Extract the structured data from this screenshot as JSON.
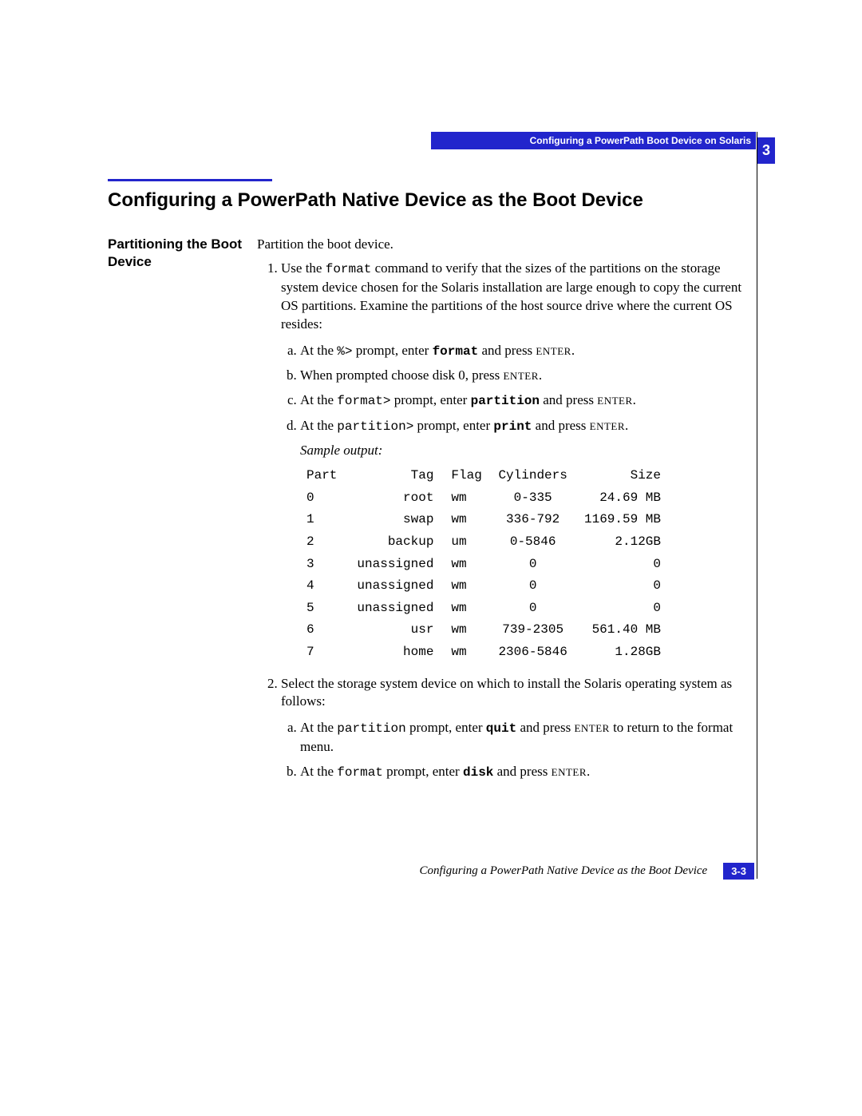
{
  "header": {
    "running": "Configuring a PowerPath Boot Device on Solaris",
    "chapter_tab": "3"
  },
  "section": {
    "title": "Configuring a PowerPath Native Device as the Boot Device"
  },
  "side": {
    "partition_heading": "Partitioning the Boot Device"
  },
  "body": {
    "intro": "Partition the boot device.",
    "step1": {
      "text_a": "Use the ",
      "cmd_format": "format",
      "text_b": " command to verify that the sizes of the partitions on the storage system device chosen for the Solaris installation are large enough to copy the current OS partitions. Examine the partitions of the host source drive where the current OS resides:",
      "a": {
        "pre": "At the ",
        "prompt": "%>",
        "mid": " prompt, enter ",
        "cmd": "format",
        "post": " and press ",
        "key": "ENTER",
        "tail": "."
      },
      "b": {
        "pre": "When prompted choose disk 0, press ",
        "key": "ENTER",
        "tail": "."
      },
      "c": {
        "pre": "At the ",
        "prompt": "format>",
        "mid": " prompt, enter ",
        "cmd": "partition",
        "post": " and press ",
        "key": "ENTER",
        "tail": "."
      },
      "d": {
        "pre": "At the ",
        "prompt": "partition>",
        "mid": " prompt, enter ",
        "cmd": "print",
        "post": " and press ",
        "key": "ENTER",
        "tail": "."
      },
      "sample_label": "Sample output:",
      "table": {
        "head": {
          "part": "Part",
          "tag": "Tag",
          "flag": "Flag",
          "cyl": "Cylinders",
          "size": "Size"
        },
        "rows": [
          {
            "part": "0",
            "tag": "root",
            "flag": "wm",
            "cyl": "0-335",
            "size": "24.69 MB"
          },
          {
            "part": "1",
            "tag": "swap",
            "flag": "wm",
            "cyl": "336-792",
            "size": "1169.59 MB"
          },
          {
            "part": "2",
            "tag": "backup",
            "flag": "um",
            "cyl": "0-5846",
            "size": "2.12GB"
          },
          {
            "part": "3",
            "tag": "unassigned",
            "flag": "wm",
            "cyl": "0",
            "size": "0"
          },
          {
            "part": "4",
            "tag": "unassigned",
            "flag": "wm",
            "cyl": "0",
            "size": "0"
          },
          {
            "part": "5",
            "tag": "unassigned",
            "flag": "wm",
            "cyl": "0",
            "size": "0"
          },
          {
            "part": "6",
            "tag": "usr",
            "flag": "wm",
            "cyl": "739-2305",
            "size": "561.40 MB"
          },
          {
            "part": "7",
            "tag": "home",
            "flag": "wm",
            "cyl": "2306-5846",
            "size": "1.28GB"
          }
        ]
      }
    },
    "step2": {
      "text": "Select the storage system device on which to install the Solaris operating system as follows:",
      "a": {
        "pre": "At the ",
        "prompt": "partition",
        "mid": " prompt, enter ",
        "cmd": "quit",
        "post": " and press ",
        "key": "ENTER",
        "tail": " to return to the format menu."
      },
      "b": {
        "pre": "At the ",
        "prompt": "format",
        "mid": " prompt, enter ",
        "cmd": "disk",
        "post": " and press ",
        "key": "ENTER",
        "tail": "."
      }
    }
  },
  "footer": {
    "title": "Configuring a PowerPath Native Device as the Boot Device",
    "page": "3-3"
  }
}
